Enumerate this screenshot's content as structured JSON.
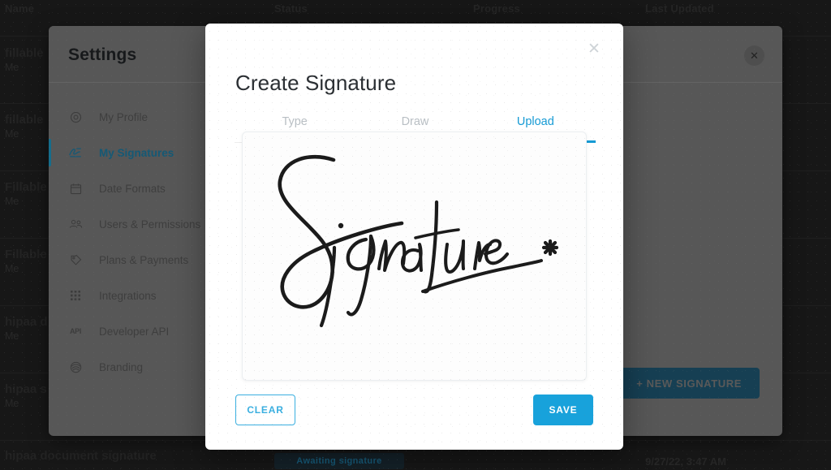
{
  "background": {
    "table_columns": [
      "Name",
      "Status",
      "Progress",
      "Last Updated"
    ],
    "rows": [
      {
        "name": "fillable",
        "owner": "Me"
      },
      {
        "name": "fillable",
        "owner": "Me"
      },
      {
        "name": "Fillable",
        "owner": "Me"
      },
      {
        "name": "Fillable",
        "owner": "Me"
      },
      {
        "name": "hipaa d",
        "owner": "Me"
      },
      {
        "name": "hipaa s",
        "owner": "Me"
      }
    ],
    "bottom_row": {
      "name": "hipaa document signature",
      "status": "Awaiting signature",
      "last_updated": "9/27/22, 3:47 AM"
    }
  },
  "settings": {
    "title": "Settings",
    "close_icon": "close-circle-icon",
    "nav": [
      {
        "label": "My Profile",
        "icon": "profile-icon",
        "active": false
      },
      {
        "label": "My Signatures",
        "icon": "signature-icon",
        "active": true
      },
      {
        "label": "Date Formats",
        "icon": "calendar-icon",
        "active": false
      },
      {
        "label": "Users & Permissions",
        "icon": "users-icon",
        "active": false
      },
      {
        "label": "Plans & Payments",
        "icon": "payments-icon",
        "active": false
      },
      {
        "label": "Integrations",
        "icon": "grid-icon",
        "active": false
      },
      {
        "label": "Developer API",
        "icon": "api-icon",
        "active": false
      },
      {
        "label": "Branding",
        "icon": "branding-icon",
        "active": false
      }
    ],
    "new_signature_button": "+  NEW SIGNATURE"
  },
  "modal": {
    "title": "Create Signature",
    "close_icon": "close-icon",
    "tabs": [
      {
        "label": "Type",
        "active": false
      },
      {
        "label": "Draw",
        "active": false
      },
      {
        "label": "Upload",
        "active": true
      }
    ],
    "canvas": {
      "name": "signature-preview",
      "content": "handwritten cursive word: Signature"
    },
    "clear_button": "CLEAR",
    "save_button": "SAVE"
  },
  "colors": {
    "accent_blue": "#18a2db",
    "accent_blue_light": "#3aafe0",
    "tab_active": "#159ad4",
    "nav_active": "#1a6d8f",
    "modal_bg": "#ffffff",
    "panel_bg": "#6b6b6b",
    "backdrop": "#1d1d1d"
  }
}
